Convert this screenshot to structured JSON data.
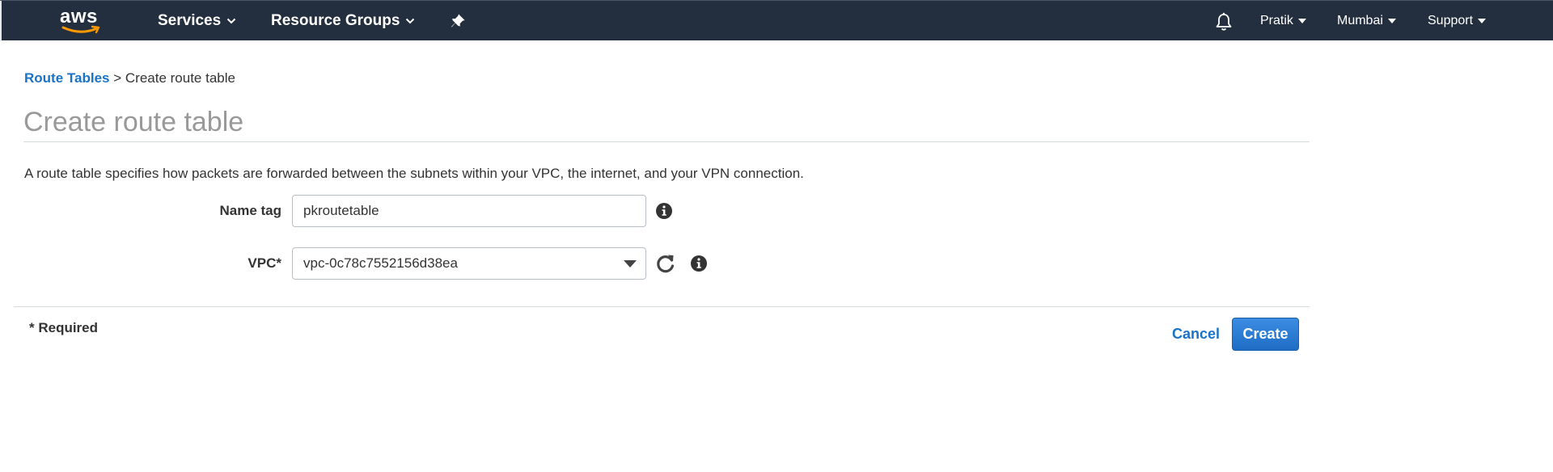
{
  "nav": {
    "logo_text": "aws",
    "services_label": "Services",
    "resource_groups_label": "Resource Groups",
    "user_label": "Pratik",
    "region_label": "Mumbai",
    "support_label": "Support",
    "icons": [
      "aws-logo",
      "chevron-down-icon",
      "pin-icon",
      "bell-icon",
      "caret-down-icon"
    ],
    "colors": {
      "bar": "#232f3e",
      "logo_smile": "#f90"
    }
  },
  "breadcrumb": {
    "parent": "Route Tables",
    "separator": ">",
    "current": "Create route table"
  },
  "page": {
    "title": "Create route table",
    "description": "A route table specifies how packets are forwarded between the subnets within your VPC, the internet, and your VPN connection."
  },
  "form": {
    "name_tag": {
      "label": "Name tag",
      "value": "pkroutetable"
    },
    "vpc": {
      "label": "VPC*",
      "value": "vpc-0c78c7552156d38ea"
    },
    "required_note": "* Required",
    "icons": [
      "info-icon",
      "refresh-icon",
      "dropdown-caret-icon"
    ]
  },
  "actions": {
    "cancel_label": "Cancel",
    "create_label": "Create",
    "colors": {
      "link": "#1a73c7",
      "primary": "#1f6dc5"
    }
  }
}
